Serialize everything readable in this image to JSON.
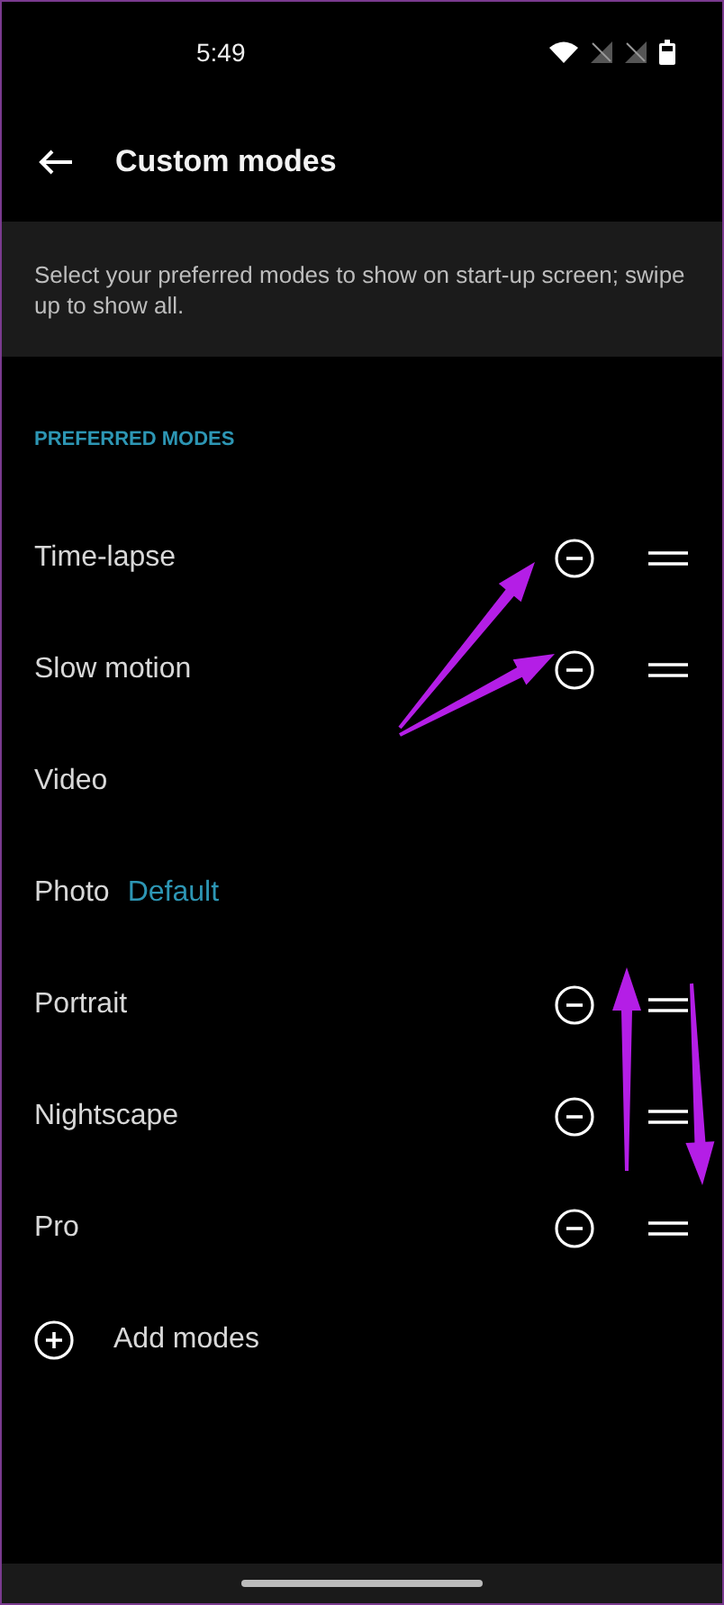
{
  "status_bar": {
    "time": "5:49"
  },
  "header": {
    "title": "Custom modes"
  },
  "info": "Select your preferred modes to show on start-up screen; swipe up to show all.",
  "section": "PREFERRED MODES",
  "modes": [
    {
      "label": "Time-lapse",
      "kind": "removable"
    },
    {
      "label": "Slow motion",
      "kind": "removable"
    },
    {
      "label": "Video",
      "kind": "fixed"
    },
    {
      "label": "Photo",
      "kind": "fixed",
      "badge": "Default"
    },
    {
      "label": "Portrait",
      "kind": "removable"
    },
    {
      "label": "Nightscape",
      "kind": "removable"
    },
    {
      "label": "Pro",
      "kind": "removable"
    }
  ],
  "add_button": "Add modes"
}
